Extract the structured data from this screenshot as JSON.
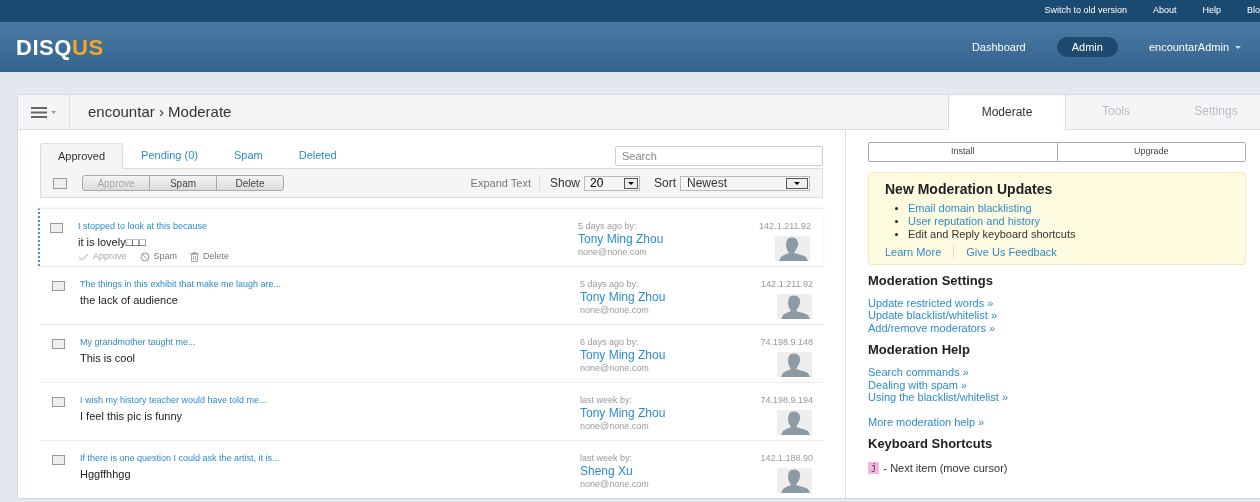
{
  "top_links": [
    "Switch to old version",
    "About",
    "Help",
    "Blo"
  ],
  "logo": {
    "part1": "DISQ",
    "part2": "US"
  },
  "nav": [
    {
      "label": "Dashboard",
      "selected": false
    },
    {
      "label": "Admin",
      "selected": true
    },
    {
      "label": "encountarAdmin",
      "selected": false,
      "dropdown": true
    }
  ],
  "breadcrumb": "encountar › Moderate",
  "page_tabs": [
    {
      "label": "Moderate",
      "selected": true
    },
    {
      "label": "Tools",
      "selected": false
    },
    {
      "label": "Settings",
      "selected": false
    }
  ],
  "filter_tabs": [
    {
      "label": "Approved",
      "selected": true
    },
    {
      "label": "Pending (0)",
      "selected": false
    },
    {
      "label": "Spam",
      "selected": false
    },
    {
      "label": "Deleted",
      "selected": false
    }
  ],
  "search": {
    "placeholder": "Search"
  },
  "select_all": {
    "checked": false
  },
  "bulk_buttons": [
    {
      "label": "Approve",
      "disabled": true
    },
    {
      "label": "Spam",
      "disabled": false
    },
    {
      "label": "Delete",
      "disabled": false
    }
  ],
  "expand_text": "Expand Text",
  "show": {
    "label": "Show",
    "value": "20"
  },
  "sort": {
    "label": "Sort",
    "value": "Newest"
  },
  "comments": [
    {
      "title": "I stopped to look at this because",
      "body": "it is lovely□□□",
      "time": "5 days ago by:",
      "author": "Tony Ming Zhou",
      "email": "none@none.com",
      "ip": "142.1.211.92",
      "active": true,
      "actions": [
        {
          "kind": "approve",
          "label": "Approve",
          "disabled": true
        },
        {
          "kind": "spam",
          "label": "Spam",
          "disabled": false
        },
        {
          "kind": "delete",
          "label": "Delete",
          "disabled": false
        }
      ]
    },
    {
      "title": "The things in this exhibit that make me laugh are...",
      "body": "the lack of audience",
      "time": "5 days ago by:",
      "author": "Tony Ming Zhou",
      "email": "none@none.com",
      "ip": "142.1.211.92",
      "active": false
    },
    {
      "title": "My grandmother taught me...",
      "body": "This is cool",
      "time": "6 days ago by:",
      "author": "Tony Ming Zhou",
      "email": "none@none.com",
      "ip": "74.198.9.148",
      "active": false
    },
    {
      "title": "I wish my history teacher would have told me...",
      "body": "I feel this pic is funny",
      "time": "last week by:",
      "author": "Tony Ming Zhou",
      "email": "none@none.com",
      "ip": "74.198.9.194",
      "active": false
    },
    {
      "title": "If there is one question I could ask the artist, it is...",
      "body": "Hggffhhgg",
      "time": "last week by:",
      "author": "Sheng Xu",
      "email": "none@none.com",
      "ip": "142.1.188.90",
      "active": false
    }
  ],
  "side_buttons": [
    "Install",
    "Upgrade"
  ],
  "updates": {
    "title": "New Moderation Updates",
    "items": [
      {
        "text": "Email domain blacklisting",
        "link": true
      },
      {
        "text": "User reputation and history",
        "link": true
      },
      {
        "text": "Edit and Reply keyboard shortcuts",
        "link": false
      }
    ],
    "links": [
      "Learn More",
      "Give Us Feedback"
    ]
  },
  "sections": [
    {
      "title": "Moderation Settings",
      "groups": [
        [
          "Update restricted words »",
          "Update blacklist/whitelist »",
          "Add/remove moderators »"
        ]
      ]
    },
    {
      "title": "Moderation Help",
      "groups": [
        [
          "Search commands »",
          "Dealing with spam »",
          "Using the blacklist/whitelist »"
        ],
        [
          "More moderation help »"
        ]
      ]
    }
  ],
  "shortcuts": {
    "title": "Keyboard Shortcuts",
    "items": [
      {
        "key": "j",
        "text": "- Next item (move cursor)"
      }
    ]
  }
}
